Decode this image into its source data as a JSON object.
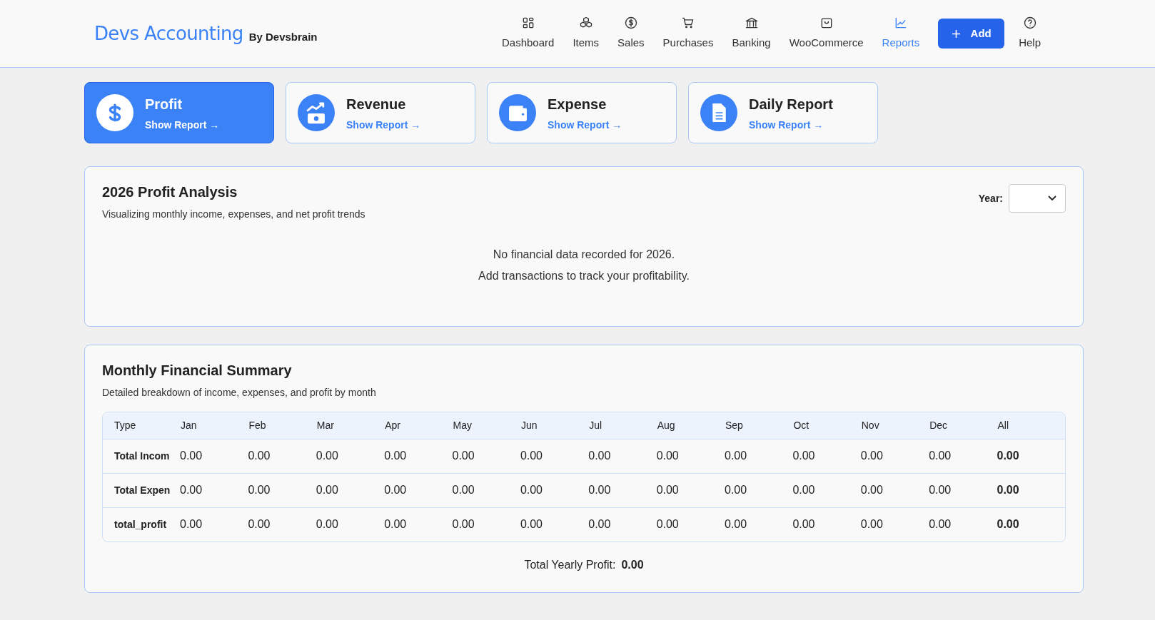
{
  "brand": {
    "title": "Devs Accounting",
    "subtitle": "By Devsbrain"
  },
  "nav": [
    {
      "label": "Dashboard",
      "selected": false
    },
    {
      "label": "Items",
      "selected": false
    },
    {
      "label": "Sales",
      "selected": false
    },
    {
      "label": "Purchases",
      "selected": false
    },
    {
      "label": "Banking",
      "selected": false
    },
    {
      "label": "WooCommerce",
      "selected": false
    },
    {
      "label": "Reports",
      "selected": true
    }
  ],
  "add_button": "Add",
  "help": "Help",
  "report_cards": [
    {
      "title": "Profit",
      "link": "Show Report →",
      "selected": true
    },
    {
      "title": "Revenue",
      "link": "Show Report →",
      "selected": false
    },
    {
      "title": "Expense",
      "link": "Show Report →",
      "selected": false
    },
    {
      "title": "Daily Report",
      "link": "Show Report →",
      "selected": false
    }
  ],
  "analysis": {
    "title": "2026 Profit Analysis",
    "subtitle": "Visualizing monthly income, expenses, and net profit trends",
    "year_label": "Year:",
    "empty_lines": [
      "No financial data recorded for 2026.",
      "Add transactions to track your profitability."
    ]
  },
  "summary": {
    "title": "Monthly Financial Summary",
    "subtitle": "Detailed breakdown of income, expenses, and profit by month",
    "columns": [
      "Type",
      "Jan",
      "Feb",
      "Mar",
      "Apr",
      "May",
      "Jun",
      "Jul",
      "Aug",
      "Sep",
      "Oct",
      "Nov",
      "Dec",
      "All"
    ],
    "rows": [
      [
        "Total Incom",
        "0.00",
        "0.00",
        "0.00",
        "0.00",
        "0.00",
        "0.00",
        "0.00",
        "0.00",
        "0.00",
        "0.00",
        "0.00",
        "0.00",
        "0.00"
      ],
      [
        "Total Expen",
        "0.00",
        "0.00",
        "0.00",
        "0.00",
        "0.00",
        "0.00",
        "0.00",
        "0.00",
        "0.00",
        "0.00",
        "0.00",
        "0.00",
        "0.00"
      ],
      [
        "total_profit",
        "0.00",
        "0.00",
        "0.00",
        "0.00",
        "0.00",
        "0.00",
        "0.00",
        "0.00",
        "0.00",
        "0.00",
        "0.00",
        "0.00",
        "0.00"
      ]
    ],
    "total_label": "Total Yearly Profit:",
    "total_value": "0.00"
  }
}
